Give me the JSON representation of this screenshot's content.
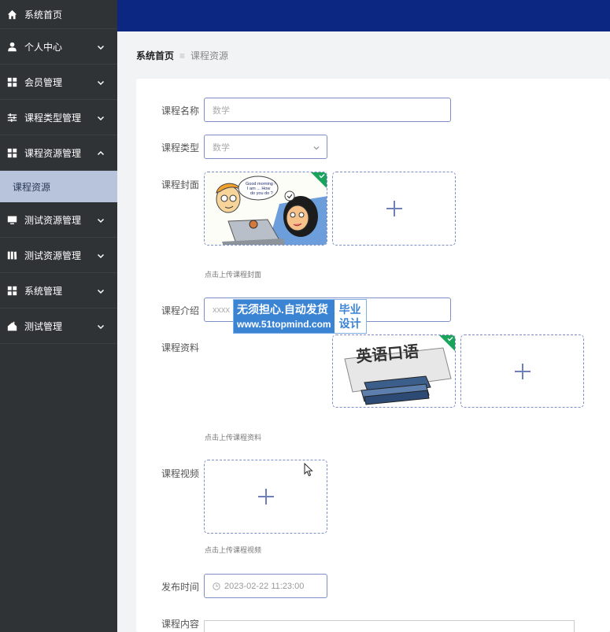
{
  "sidebar": {
    "items": [
      {
        "label": "系统首页",
        "icon": "home-icon",
        "has_arrow": false
      },
      {
        "label": "个人中心",
        "icon": "user-icon",
        "has_arrow": true
      },
      {
        "label": "会员管理",
        "icon": "grid-icon",
        "has_arrow": true
      },
      {
        "label": "课程类型管理",
        "icon": "sliders-icon",
        "has_arrow": true
      },
      {
        "label": "课程资源管理",
        "icon": "grid-icon",
        "has_arrow": true,
        "expanded": true
      },
      {
        "label": "测试资源管理",
        "icon": "monitor-icon",
        "has_arrow": true
      },
      {
        "label": "测试资源管理",
        "icon": "book-icon",
        "has_arrow": true
      },
      {
        "label": "系统管理",
        "icon": "grid-icon",
        "has_arrow": true
      },
      {
        "label": "测试管理",
        "icon": "home-box-icon",
        "has_arrow": true
      }
    ],
    "submenu_active": "课程资源"
  },
  "breadcrumb": {
    "home": "系统首页",
    "separator": "≡",
    "current": "课程资源"
  },
  "form": {
    "name_label": "课程名称",
    "name_placeholder": "数学",
    "type_label": "课程类型",
    "type_value": "数学",
    "cover_label": "课程封面",
    "cover_hint": "点击上传课程封面",
    "cover_image_text": [
      "Good morning !",
      "I am ... How",
      "do you do ?"
    ],
    "intro_label": "课程介绍",
    "intro_value": "xxxx",
    "material_label": "课程资料",
    "material_hint": "点击上传课程资料",
    "material_image_text": "英语口语",
    "video_label": "课程视频",
    "video_hint": "点击上传课程视频",
    "publish_label": "发布时间",
    "publish_value": "2023-02-22 11:23:00",
    "content_label": "课程内容"
  },
  "watermark": {
    "line1": "无须担心.自动发货",
    "line2": "www.51topmind.com",
    "right1": "毕业",
    "right2": "设计"
  },
  "colors": {
    "sidebar_bg": "#2f3336",
    "topbar_bg": "#0b2782",
    "submenu_active_bg": "#b8c4dc",
    "input_border": "#7d8fc6",
    "badge_green": "#19a35b"
  }
}
